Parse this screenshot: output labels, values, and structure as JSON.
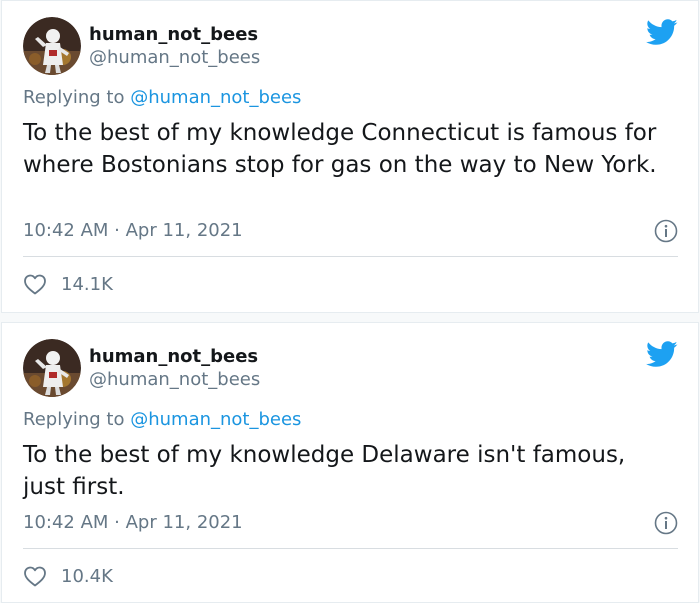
{
  "colors": {
    "text_primary": "#14171a",
    "text_secondary": "#657786",
    "mention": "#1b95e0",
    "twitter_blue": "#1da1f2",
    "divider": "#d8dde1"
  },
  "tweets": [
    {
      "display_name": "human_not_bees",
      "handle": "@human_not_bees",
      "replying_label": "Replying to",
      "replying_to": "@human_not_bees",
      "text": "To the best of my knowledge Connecticut is famous for where Bostonians stop for gas on the way to New York.",
      "timestamp": "10:42 AM · Apr 11, 2021",
      "likes": "14.1K",
      "icons": [
        "avatar",
        "twitter-bird-icon",
        "info-icon",
        "heart-icon"
      ]
    },
    {
      "display_name": "human_not_bees",
      "handle": "@human_not_bees",
      "replying_label": "Replying to",
      "replying_to": "@human_not_bees",
      "text": "To the best of my knowledge Delaware isn't famous, just first.",
      "timestamp": "10:42 AM · Apr 11, 2021",
      "likes": "10.4K",
      "icons": [
        "avatar",
        "twitter-bird-icon",
        "info-icon",
        "heart-icon"
      ]
    }
  ]
}
